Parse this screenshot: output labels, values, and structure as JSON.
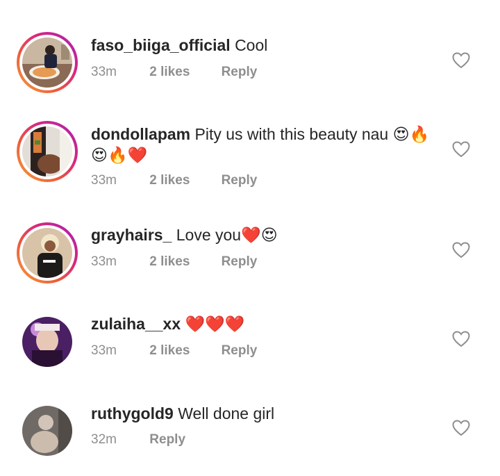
{
  "comments": [
    {
      "username": "faso_biiga_official",
      "text": "Cool",
      "time": "33m",
      "likes": "2 likes",
      "reply": "Reply",
      "avatar_icon": "user-photo-food",
      "has_story_ring": true
    },
    {
      "username": "dondollapam",
      "text": "Pity us with this beauty nau 😍🔥😍🔥❤️",
      "time": "33m",
      "likes": "2 likes",
      "reply": "Reply",
      "avatar_icon": "user-photo",
      "has_story_ring": true
    },
    {
      "username": "grayhairs_",
      "text": "Love you❤️😍",
      "time": "33m",
      "likes": "2 likes",
      "reply": "Reply",
      "avatar_icon": "user-photo",
      "has_story_ring": true
    },
    {
      "username": "zulaiha__xx",
      "text": "❤️❤️❤️",
      "time": "33m",
      "likes": "2 likes",
      "reply": "Reply",
      "avatar_icon": "user-photo",
      "has_story_ring": false
    },
    {
      "username": "ruthygold9",
      "text": "Well done girl",
      "time": "32m",
      "likes": "",
      "reply": "Reply",
      "avatar_icon": "user-photo",
      "has_story_ring": false
    }
  ],
  "icons": {
    "like": "heart-outline-icon"
  },
  "colors": {
    "primary_text": "#262626",
    "secondary_text": "#8e8e8e",
    "ring_start": "#f6a23a",
    "ring_end": "#a223b8"
  }
}
